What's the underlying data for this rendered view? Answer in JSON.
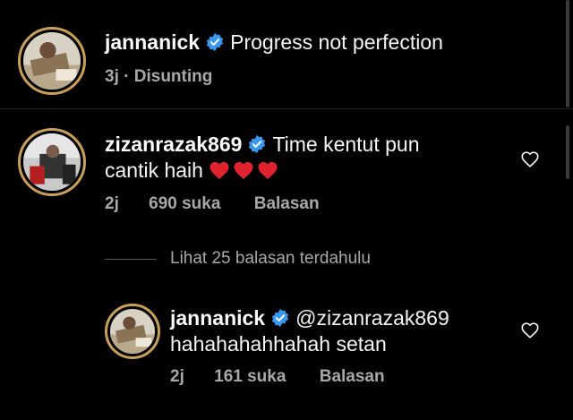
{
  "caption": {
    "username": "jannanick",
    "text": "Progress not perfection",
    "time": "3j",
    "separator": "·",
    "edited": "Disunting"
  },
  "comment": {
    "username": "zizanrazak869",
    "text_line1": "Time kentut pun",
    "text_line2": "cantik haih",
    "emoji": "heart-emoji x3",
    "time": "2j",
    "likes": "690 suka",
    "reply_label": "Balasan"
  },
  "view_replies": "Lihat 25 balasan terdahulu",
  "reply": {
    "username": "jannanick",
    "mention": "@zizanrazak869",
    "text": "hahahahahhahah setan",
    "time": "2j",
    "likes": "161 suka",
    "reply_label": "Balasan"
  },
  "colors": {
    "background": "#000000",
    "verified": "#3897f0",
    "heart_emoji": "#e0242f",
    "muted_text": "#a8a8a8"
  }
}
